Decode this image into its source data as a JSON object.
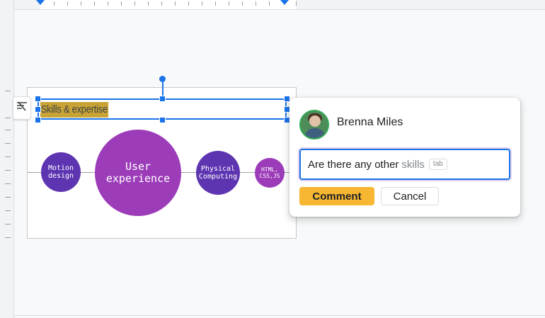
{
  "slide": {
    "title": "Skills & expertise",
    "circles": [
      {
        "label_line1": "Motion",
        "label_line2": "design",
        "color": "#5e35b1"
      },
      {
        "label_line1": "User",
        "label_line2": "experience",
        "color": "#9c3cb8"
      },
      {
        "label_line1": "Physical",
        "label_line2": "Computing",
        "color": "#5e35b1"
      },
      {
        "label_line1": "HTML,",
        "label_line2": "CSS,JS",
        "color": "#9c3cb8"
      }
    ],
    "side_button_icon": "format-clear-icon"
  },
  "comment": {
    "author": "Brenna Miles",
    "input_text": "Are there any other",
    "suggestion": "skills",
    "tab_hint": "tab",
    "comment_button": "Comment",
    "cancel_button": "Cancel",
    "accent_color": "#f7b733",
    "focus_color": "#1a73e8"
  }
}
